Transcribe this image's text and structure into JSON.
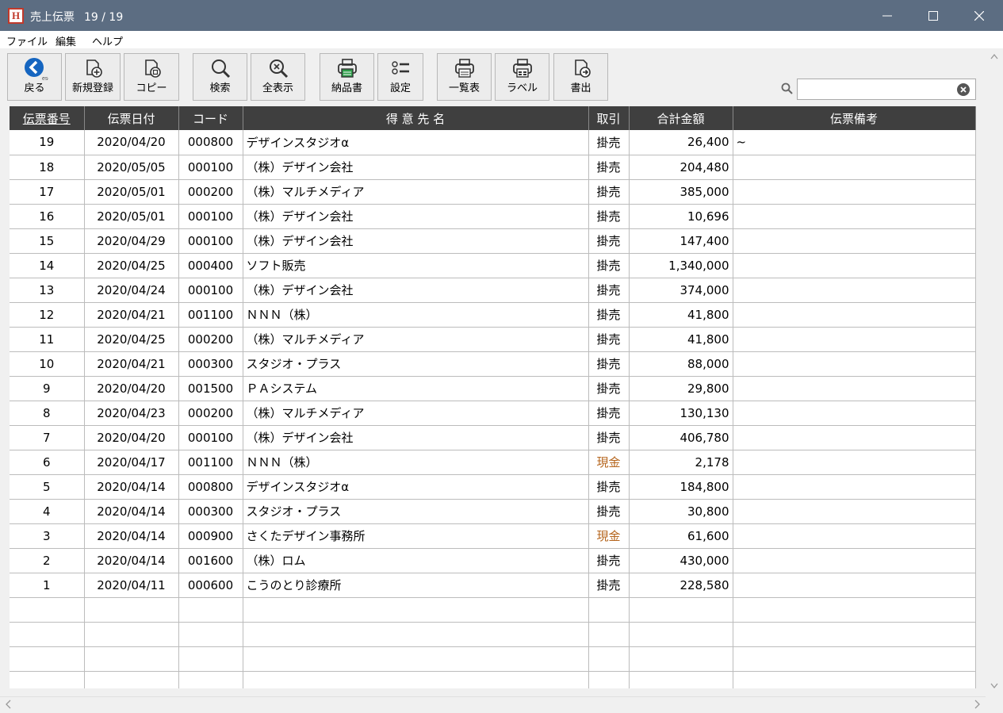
{
  "window": {
    "logo_letter": "H",
    "title": "売上伝票",
    "counter": "19 / 19"
  },
  "menu": [
    "ファイル",
    "編集",
    "ヘルプ"
  ],
  "toolbar": {
    "back": "戻る",
    "back_hint": "esc",
    "new": "新規登録",
    "copy": "コピー",
    "search": "検索",
    "show_all": "全表示",
    "delivery": "納品書",
    "settings": "設定",
    "list": "一覧表",
    "label": "ラベル",
    "export": "書出"
  },
  "search": {
    "value": ""
  },
  "table": {
    "headers": [
      "伝票番号",
      "伝票日付",
      "コード",
      "得 意 先 名",
      "取引",
      "合計金額",
      "伝票備考"
    ],
    "rows": [
      [
        "19",
        "2020/04/20",
        "000800",
        "デザインスタジオα",
        "掛売",
        "26,400",
        "~"
      ],
      [
        "18",
        "2020/05/05",
        "000100",
        "（株）デザイン会社",
        "掛売",
        "204,480",
        ""
      ],
      [
        "17",
        "2020/05/01",
        "000200",
        "（株）マルチメディア",
        "掛売",
        "385,000",
        ""
      ],
      [
        "16",
        "2020/05/01",
        "000100",
        "（株）デザイン会社",
        "掛売",
        "10,696",
        ""
      ],
      [
        "15",
        "2020/04/29",
        "000100",
        "（株）デザイン会社",
        "掛売",
        "147,400",
        ""
      ],
      [
        "14",
        "2020/04/25",
        "000400",
        "ソフト販売",
        "掛売",
        "1,340,000",
        ""
      ],
      [
        "13",
        "2020/04/24",
        "000100",
        "（株）デザイン会社",
        "掛売",
        "374,000",
        ""
      ],
      [
        "12",
        "2020/04/21",
        "001100",
        "ＮＮＮ（株）",
        "掛売",
        "41,800",
        ""
      ],
      [
        "11",
        "2020/04/25",
        "000200",
        "（株）マルチメディア",
        "掛売",
        "41,800",
        ""
      ],
      [
        "10",
        "2020/04/21",
        "000300",
        "スタジオ・プラス",
        "掛売",
        "88,000",
        ""
      ],
      [
        "9",
        "2020/04/20",
        "001500",
        "ＰＡシステム",
        "掛売",
        "29,800",
        ""
      ],
      [
        "8",
        "2020/04/23",
        "000200",
        "（株）マルチメディア",
        "掛売",
        "130,130",
        ""
      ],
      [
        "7",
        "2020/04/20",
        "000100",
        "（株）デザイン会社",
        "掛売",
        "406,780",
        ""
      ],
      [
        "6",
        "2020/04/17",
        "001100",
        "ＮＮＮ（株）",
        "現金",
        "2,178",
        ""
      ],
      [
        "5",
        "2020/04/14",
        "000800",
        "デザインスタジオα",
        "掛売",
        "184,800",
        ""
      ],
      [
        "4",
        "2020/04/14",
        "000300",
        "スタジオ・プラス",
        "掛売",
        "30,800",
        ""
      ],
      [
        "3",
        "2020/04/14",
        "000900",
        "さくたデザイン事務所",
        "現金",
        "61,600",
        ""
      ],
      [
        "2",
        "2020/04/14",
        "001600",
        "（株）ロム",
        "掛売",
        "430,000",
        ""
      ],
      [
        "1",
        "2020/04/11",
        "000600",
        "こうのとり診療所",
        "掛売",
        "228,580",
        ""
      ]
    ],
    "empty_rows": 4
  },
  "colors": {
    "titlebar": "#5c6d82",
    "header_bg": "#3f3f3f",
    "cash_text": "#b5651d",
    "back_button": "#1565c0"
  }
}
